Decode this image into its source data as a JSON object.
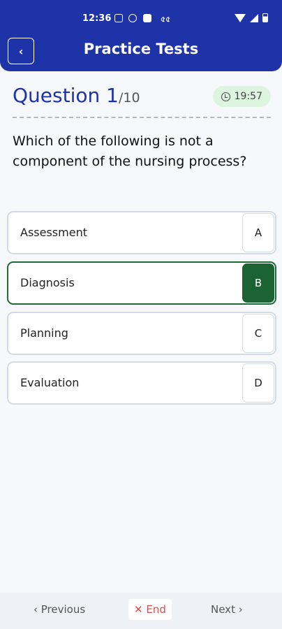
{
  "status": {
    "time": "12:36",
    "extra": "৫৫"
  },
  "header": {
    "title": "Practice Tests",
    "back_icon": "‹"
  },
  "question": {
    "label": "Question 1",
    "total": "/10",
    "timer": "19:57",
    "text": "Which of the following is not a component of the nursing process?"
  },
  "options": [
    {
      "label": "Assessment",
      "letter": "A"
    },
    {
      "label": "Diagnosis",
      "letter": "B"
    },
    {
      "label": "Planning",
      "letter": "C"
    },
    {
      "label": "Evaluation",
      "letter": "D"
    }
  ],
  "selected_option": "B",
  "footer": {
    "previous": "‹ Previous",
    "end": "✕ End",
    "next": "Next ›"
  },
  "colors": {
    "brand": "#1e33a8",
    "selected": "#1b6333",
    "end": "#e04b4b",
    "timer_bg": "#ddf5df"
  }
}
